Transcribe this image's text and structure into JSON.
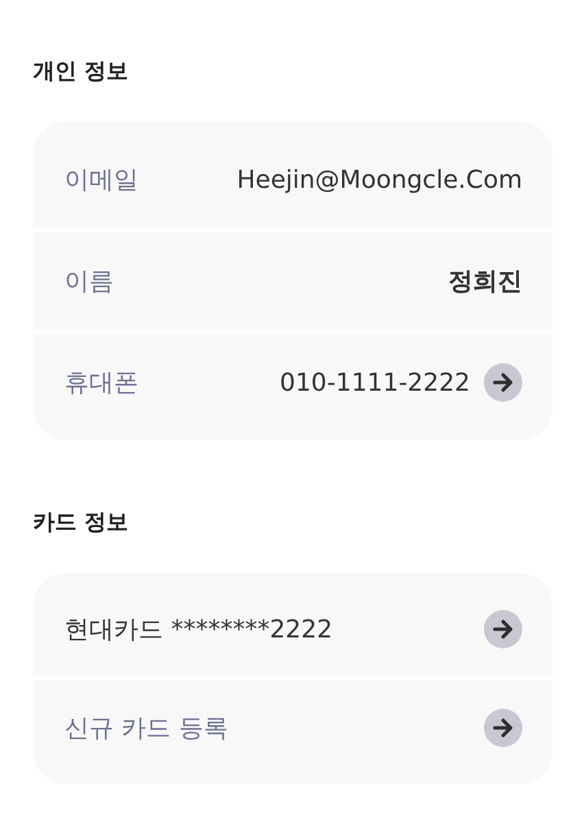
{
  "sections": [
    {
      "title": "개인 정보",
      "rows": [
        {
          "kind": "field",
          "label": "이메일",
          "value": "Heejin@Moongcle.Com"
        },
        {
          "kind": "name",
          "label": "이름",
          "value": "정희진"
        },
        {
          "kind": "link",
          "label": "휴대폰",
          "value": "010-1111-2222"
        }
      ]
    },
    {
      "title": "카드 정보",
      "rows": [
        {
          "kind": "card",
          "label": "현대카드 ********2222"
        },
        {
          "kind": "add",
          "label": "신규 카드 등록"
        }
      ]
    }
  ]
}
